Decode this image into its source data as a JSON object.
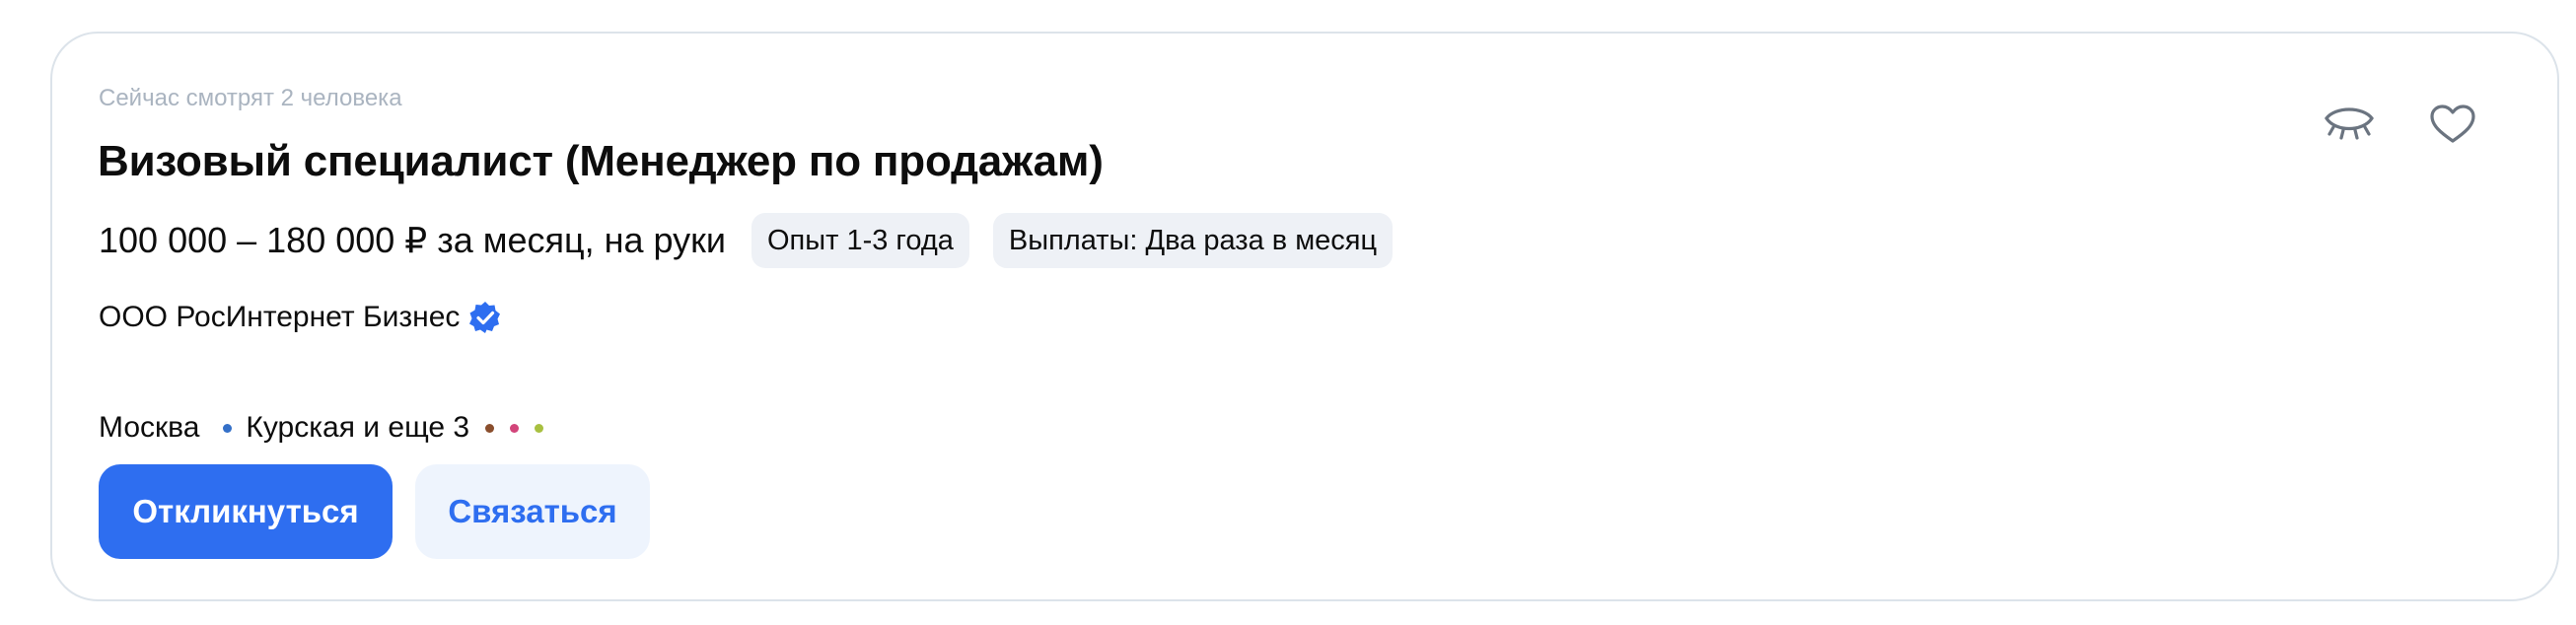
{
  "vacancy": {
    "viewers_text": "Сейчас смотрят 2 человека",
    "title": "Визовый специалист (Менеджер по продажам)",
    "salary": "100 000 – 180 000 ₽ за месяц, на руки",
    "experience_chip": "Опыт 1-3 года",
    "payouts_chip": "Выплаты: Два раза в месяц",
    "company": "ООО РосИнтернет Бизнес",
    "city": "Москва",
    "metro": "Курская и еще 3",
    "apply_label": "Откликнуться",
    "contact_label": "Связаться"
  },
  "icons": {
    "hide": "eye-closed-icon",
    "favorite": "heart-icon",
    "verified": "verified-check-icon"
  },
  "colors": {
    "accent": "#2e6ef0",
    "metro_main": "#3470c8",
    "metro_extra": [
      "#8a4e2d",
      "#d2457a",
      "#a8c040"
    ]
  }
}
